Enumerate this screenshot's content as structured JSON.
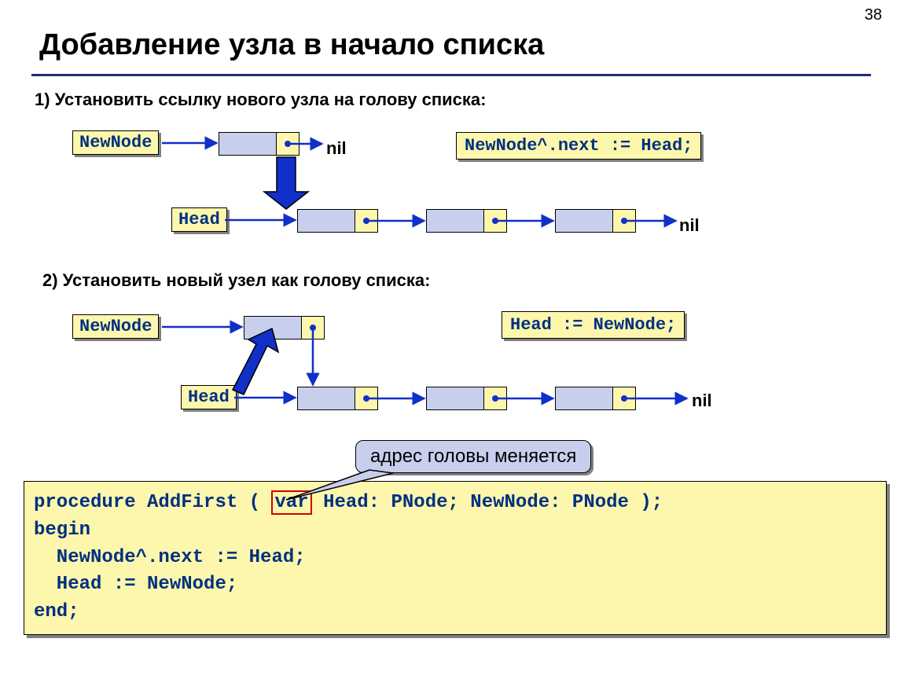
{
  "page_number": "38",
  "title": "Добавление узла в начало списка",
  "step1_text": "1) Установить ссылку нового узла на голову списка:",
  "step2_text": "2) Установить новый узел как голову списка:",
  "labels": {
    "new_node": "NewNode",
    "head": "Head",
    "nil": "nil"
  },
  "code1": "NewNode^.next := Head;",
  "code2": "Head := NewNode;",
  "callout": "адрес головы меняется",
  "procedure": {
    "line1_a": "procedure AddFirst ( ",
    "line1_var": "var",
    "line1_b": " Head: PNode; NewNode: PNode );",
    "line2": "begin",
    "line3": "  NewNode^.next := Head;",
    "line4": "  Head := NewNode;",
    "line5": "end;"
  }
}
